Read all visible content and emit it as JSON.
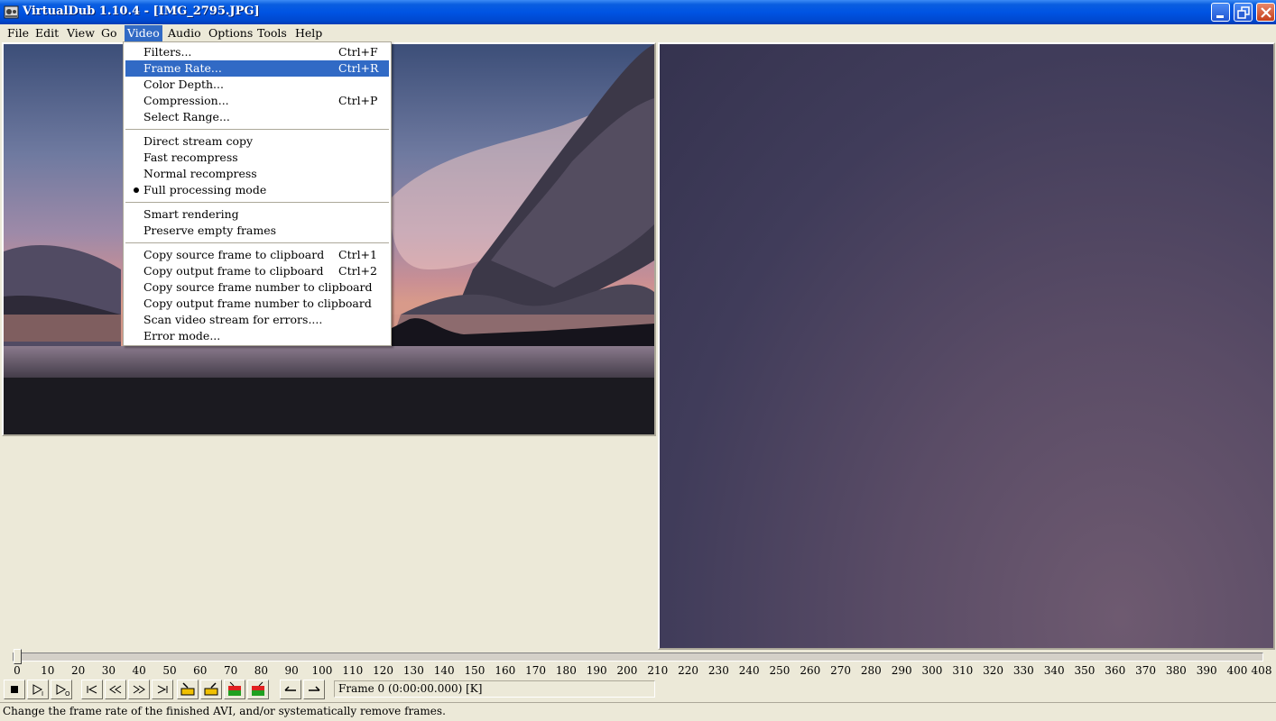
{
  "window": {
    "title": "VirtualDub 1.10.4 - [IMG_2795.JPG]"
  },
  "menubar": {
    "items": [
      {
        "label": "File"
      },
      {
        "label": "Edit"
      },
      {
        "label": "View"
      },
      {
        "label": "Go"
      },
      {
        "label": "Video"
      },
      {
        "label": "Audio"
      },
      {
        "label": "Options"
      },
      {
        "label": "Tools"
      },
      {
        "label": "Help"
      }
    ],
    "active": "Video"
  },
  "video_menu": {
    "filters": {
      "label": "Filters...",
      "shortcut": "Ctrl+F"
    },
    "frame_rate": {
      "label": "Frame Rate...",
      "shortcut": "Ctrl+R"
    },
    "color_depth": {
      "label": "Color Depth..."
    },
    "compression": {
      "label": "Compression...",
      "shortcut": "Ctrl+P"
    },
    "select_range": {
      "label": "Select Range..."
    },
    "direct_stream_copy": {
      "label": "Direct stream copy"
    },
    "fast_recompress": {
      "label": "Fast recompress"
    },
    "normal_recompress": {
      "label": "Normal recompress"
    },
    "full_processing_mode": {
      "label": "Full processing mode",
      "selected": true
    },
    "smart_rendering": {
      "label": "Smart rendering"
    },
    "preserve_empty_frames": {
      "label": "Preserve empty frames"
    },
    "copy_source_frame": {
      "label": "Copy source frame to clipboard",
      "shortcut": "Ctrl+1"
    },
    "copy_output_frame": {
      "label": "Copy output frame to clipboard",
      "shortcut": "Ctrl+2"
    },
    "copy_source_frame_number": {
      "label": "Copy source frame number to clipboard"
    },
    "copy_output_frame_number": {
      "label": "Copy output frame number to clipboard"
    },
    "scan_video_stream": {
      "label": "Scan video stream for errors...."
    },
    "error_mode": {
      "label": "Error mode..."
    }
  },
  "timeline": {
    "ticks": [
      "0",
      "10",
      "20",
      "30",
      "40",
      "50",
      "60",
      "70",
      "80",
      "90",
      "100",
      "110",
      "120",
      "130",
      "140",
      "150",
      "160",
      "170",
      "180",
      "190",
      "200",
      "210",
      "220",
      "230",
      "240",
      "250",
      "260",
      "270",
      "280",
      "290",
      "300",
      "310",
      "320",
      "330",
      "340",
      "350",
      "360",
      "370",
      "380",
      "390",
      "400",
      "408"
    ],
    "position_frame": 0
  },
  "toolbar": {
    "buttons": [
      "stop-icon",
      "play-input-icon",
      "play-output-icon",
      "go-start-icon",
      "prev-frame-icon",
      "next-frame-icon",
      "go-end-icon",
      "prev-keyframe-icon",
      "next-keyframe-icon",
      "prev-scene-icon",
      "next-scene-icon",
      "mark-in-icon",
      "mark-out-icon"
    ],
    "frame_status": "Frame 0 (0:00:00.000) [K]"
  },
  "status": {
    "text": "Change the frame rate of the finished AVI, and/or systematically remove frames."
  },
  "colors": {
    "titlebar": "#0054e3",
    "menu_highlight": "#316ac5",
    "chrome": "#ece9d8"
  }
}
